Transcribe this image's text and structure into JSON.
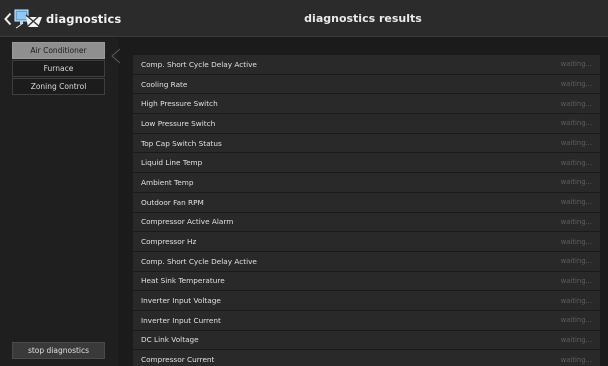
{
  "header": {
    "back_label": "diagnostics",
    "title": "diagnostics results"
  },
  "sidebar": {
    "items": [
      {
        "label": "Air Conditioner",
        "active": true
      },
      {
        "label": "Furnace",
        "active": false
      },
      {
        "label": "Zoning Control",
        "active": false
      }
    ],
    "stop_label": "stop diagnostics"
  },
  "results": {
    "rows": [
      {
        "label": "Comp. Short Cycle Delay Active",
        "status": "waiting..."
      },
      {
        "label": "Cooling Rate",
        "status": "waiting..."
      },
      {
        "label": "High Pressure Switch",
        "status": "waiting..."
      },
      {
        "label": "Low Pressure Switch",
        "status": "waiting..."
      },
      {
        "label": "Top Cap Switch Status",
        "status": "waiting..."
      },
      {
        "label": "Liquid Line Temp",
        "status": "waiting..."
      },
      {
        "label": "Ambient Temp",
        "status": "waiting..."
      },
      {
        "label": "Outdoor Fan RPM",
        "status": "waiting..."
      },
      {
        "label": "Compressor Active Alarm",
        "status": "waiting..."
      },
      {
        "label": "Compressor Hz",
        "status": "waiting..."
      },
      {
        "label": "Comp. Short Cycle Delay Active",
        "status": "waiting..."
      },
      {
        "label": "Heat Sink Temperature",
        "status": "waiting..."
      },
      {
        "label": "Inverter Input Voltage",
        "status": "waiting..."
      },
      {
        "label": "Inverter Input Current",
        "status": "waiting..."
      },
      {
        "label": "DC Link Voltage",
        "status": "waiting..."
      },
      {
        "label": "Compressor Current",
        "status": "waiting..."
      }
    ]
  },
  "icons": {
    "back": "chevron-left-icon",
    "logo": "diagnostics-logo-icon",
    "divider": "chevron-left-divider-icon"
  },
  "colors": {
    "active_menu_bg": "#8f8f8f",
    "row_bg": "#292929",
    "status_text": "#5e5e5e"
  }
}
